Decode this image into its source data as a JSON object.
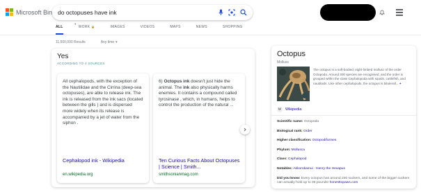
{
  "brand": {
    "name": "Microsoft Bing",
    "colors": [
      "#f25022",
      "#7fba00",
      "#00a4ef",
      "#ffb900"
    ]
  },
  "search": {
    "value": "do octopuses have ink",
    "icons": [
      "microphone-icon",
      "visual-search-icon",
      "search-icon"
    ]
  },
  "header": {
    "icons": [
      "bell-icon",
      "hamburger-menu-icon"
    ]
  },
  "tabs": {
    "all": "ALL",
    "work": "WORK",
    "images": "IMAGES",
    "videos": "VIDEOS",
    "maps": "MAPS",
    "news": "NEWS",
    "shopping": "SHOPPING"
  },
  "meta": {
    "results_count": "11,500,000 Results",
    "time_filter": "Any time"
  },
  "answer": {
    "title": "Yes",
    "subtitle": "ACCORDING TO 4 SOURCES",
    "snippets": [
      {
        "body": "All cephalopods, with the exception of the Nautilidae and the Cirrina (deep-sea octopuses), are able to release ink. The ink is released from the ink sacs (located between the gills ) and is dispersed more widely when its release is accompanied by a jet of water from the siphon .",
        "link": "Cephalopod ink - Wikipedia",
        "url": "en.wikipedia.org"
      },
      {
        "body_prefix": "6) ",
        "body_bold1": "Octopus ink",
        "body_mid1": " doesn't just hide the animal. The ",
        "body_bold2": "ink",
        "body_rest": " also physically harms enemies. It contains a compound called tyrosinase , which, in humans, helps to control the production of the natural ...",
        "link": "Ten Curious Facts About Octopuses | Science | Smith...",
        "url": "smithsonianmag.com"
      }
    ]
  },
  "knowledge_panel": {
    "title": "Octopus",
    "subtitle": "Mollusc",
    "description": "The octopus is a soft-bodied, eight-limbed mollusc of the order Octopoda. Around 300 species are recognised, and the order is grouped within the class Cephalopoda with squids, cuttlefish, and nautiloids. Like other cephalopods, the octopus is bilaterall...",
    "more_symbol": "+",
    "wiki_label": "Wikipedia",
    "wiki_glyph": "W",
    "facts": {
      "scientific_name_label": "Scientific name:",
      "scientific_name_value": "Octopoda",
      "biological_rank_label": "Biological rank:",
      "biological_rank_value": "Order",
      "higher_class_label": "Higher classification:",
      "higher_class_value": "Octopodiformes",
      "phylum_label": "Phylum:",
      "phylum_value": "Mollusca",
      "class_label": "Class:",
      "class_value": "Cephalopod",
      "notables_label": "Notables:",
      "notables_value1": "Akkorokamui",
      "notables_sep": " · ",
      "notables_value2": "Henry the Hexapus",
      "dyk_label": "Did you know:",
      "dyk_text": " Every octopus has around 240 suckers, and some of the bigger suckers can actually hold up to 35 pounds! ",
      "dyk_link": "honesttopaws.com"
    }
  }
}
